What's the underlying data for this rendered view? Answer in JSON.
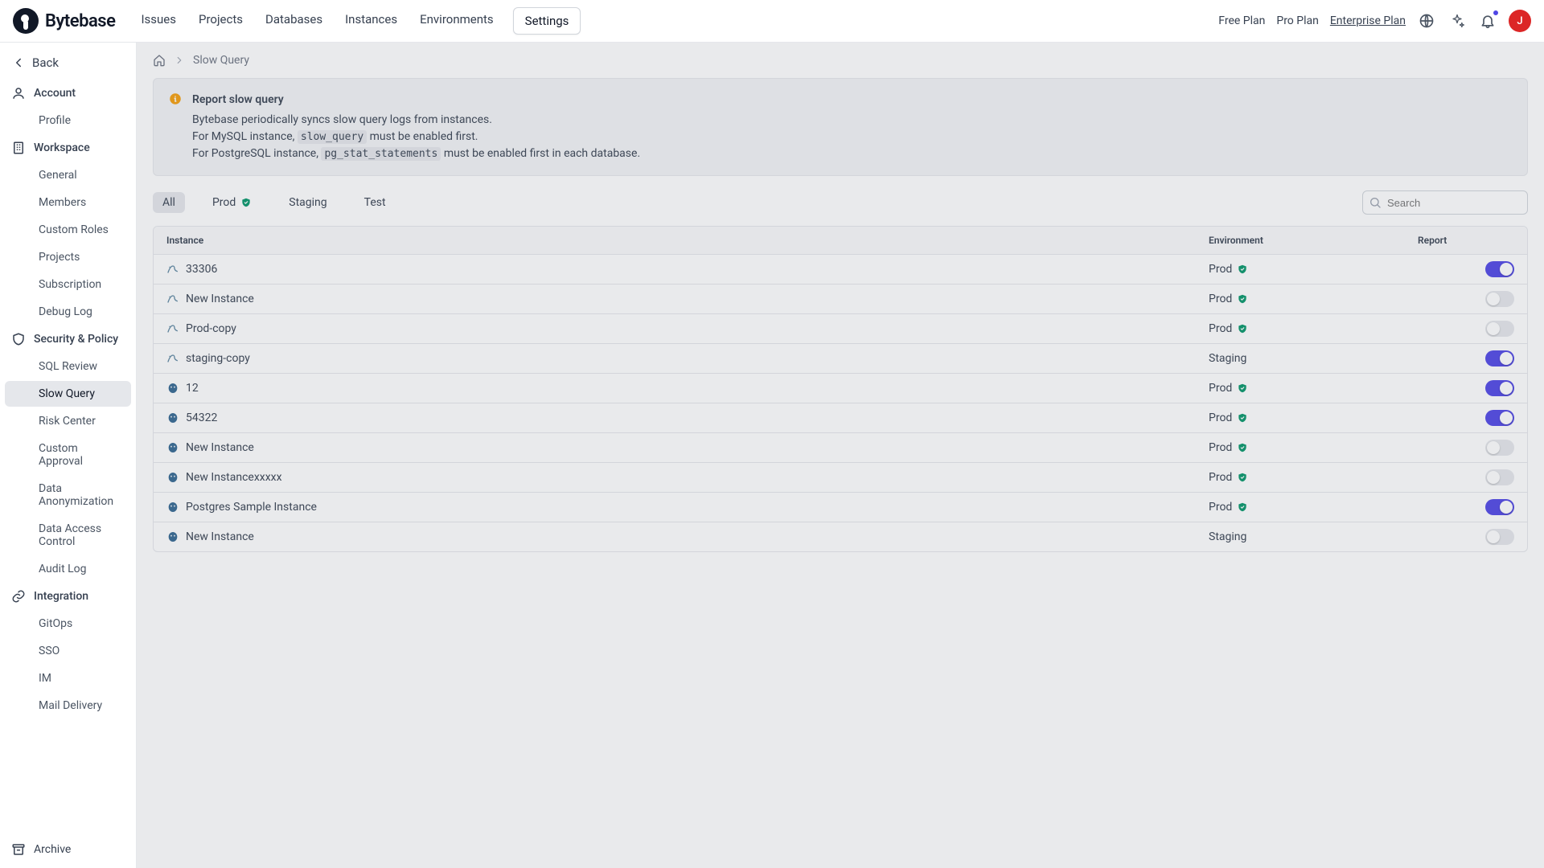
{
  "brand": {
    "name": "Bytebase"
  },
  "nav": {
    "items": [
      {
        "label": "Issues"
      },
      {
        "label": "Projects"
      },
      {
        "label": "Databases"
      },
      {
        "label": "Instances"
      },
      {
        "label": "Environments"
      },
      {
        "label": "Settings",
        "active": true
      }
    ]
  },
  "plans": {
    "free": "Free Plan",
    "pro": "Pro Plan",
    "enterprise": "Enterprise Plan"
  },
  "avatar_initial": "J",
  "back_label": "Back",
  "sidebar": {
    "sections": [
      {
        "title": "Account",
        "items": [
          {
            "label": "Profile"
          }
        ]
      },
      {
        "title": "Workspace",
        "items": [
          {
            "label": "General"
          },
          {
            "label": "Members"
          },
          {
            "label": "Custom Roles"
          },
          {
            "label": "Projects"
          },
          {
            "label": "Subscription"
          },
          {
            "label": "Debug Log"
          }
        ]
      },
      {
        "title": "Security & Policy",
        "items": [
          {
            "label": "SQL Review"
          },
          {
            "label": "Slow Query",
            "active": true
          },
          {
            "label": "Risk Center"
          },
          {
            "label": "Custom Approval"
          },
          {
            "label": "Data Anonymization"
          },
          {
            "label": "Data Access Control"
          },
          {
            "label": "Audit Log"
          }
        ]
      },
      {
        "title": "Integration",
        "items": [
          {
            "label": "GitOps"
          },
          {
            "label": "SSO"
          },
          {
            "label": "IM"
          },
          {
            "label": "Mail Delivery"
          }
        ]
      }
    ],
    "archive_label": "Archive"
  },
  "breadcrumb": {
    "current": "Slow Query"
  },
  "info": {
    "title": "Report slow query",
    "line1": "Bytebase periodically syncs slow query logs from instances.",
    "line2_pre": "For MySQL instance, ",
    "line2_code": "slow_query",
    "line2_post": " must be enabled first.",
    "line3_pre": "For PostgreSQL instance, ",
    "line3_code": "pg_stat_statements",
    "line3_post": " must be enabled first in each database."
  },
  "tabs": [
    {
      "label": "All",
      "active": true
    },
    {
      "label": "Prod",
      "shield": true
    },
    {
      "label": "Staging"
    },
    {
      "label": "Test"
    }
  ],
  "search_placeholder": "Search",
  "table": {
    "columns": {
      "instance": "Instance",
      "environment": "Environment",
      "report": "Report"
    },
    "rows": [
      {
        "db": "mysql",
        "name": "33306",
        "env": "Prod",
        "shield": true,
        "on": true
      },
      {
        "db": "mysql",
        "name": "New Instance",
        "env": "Prod",
        "shield": true,
        "on": false
      },
      {
        "db": "mysql",
        "name": "Prod-copy",
        "env": "Prod",
        "shield": true,
        "on": false
      },
      {
        "db": "mysql",
        "name": "staging-copy",
        "env": "Staging",
        "shield": false,
        "on": true
      },
      {
        "db": "postgres",
        "name": "12",
        "env": "Prod",
        "shield": true,
        "on": true
      },
      {
        "db": "postgres",
        "name": "54322",
        "env": "Prod",
        "shield": true,
        "on": true
      },
      {
        "db": "postgres",
        "name": "New Instance",
        "env": "Prod",
        "shield": true,
        "on": false
      },
      {
        "db": "postgres",
        "name": "New Instancexxxxx",
        "env": "Prod",
        "shield": true,
        "on": false
      },
      {
        "db": "postgres",
        "name": "Postgres Sample Instance",
        "env": "Prod",
        "shield": true,
        "on": true
      },
      {
        "db": "postgres",
        "name": "New Instance",
        "env": "Staging",
        "shield": false,
        "on": false
      }
    ]
  }
}
